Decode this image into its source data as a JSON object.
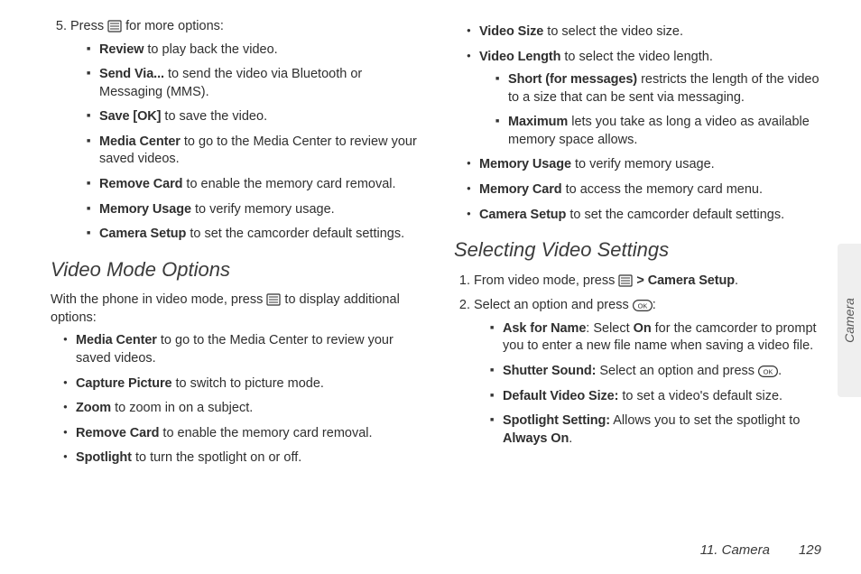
{
  "left": {
    "step5_lead": "Press ",
    "step5_tail": " for more options:",
    "step5_items": [
      {
        "term": "Review",
        "rest": " to play back the video."
      },
      {
        "term": "Send Via...",
        "rest": " to send the video via Bluetooth or Messaging (MMS)."
      },
      {
        "term": "Save [OK]",
        "rest": " to save the video."
      },
      {
        "term": "Media Center",
        "rest": " to go to the Media Center to review your saved videos."
      },
      {
        "term": "Remove Card",
        "rest": " to enable the memory card removal."
      },
      {
        "term": "Memory Usage",
        "rest": " to verify memory usage."
      },
      {
        "term": "Camera Setup",
        "rest": " to set the camcorder default settings."
      }
    ],
    "heading": "Video Mode Options",
    "intro_lead": "With the phone in video mode, press ",
    "intro_tail": " to display additional options:",
    "bullets": [
      {
        "term": "Media Center",
        "rest": " to go to the Media Center to review your saved videos."
      },
      {
        "term": "Capture Picture",
        "rest": " to switch to picture mode."
      },
      {
        "term": "Zoom",
        "rest": " to zoom in on a subject."
      },
      {
        "term": "Remove Card",
        "rest": " to enable the memory card removal."
      },
      {
        "term": "Spotlight",
        "rest": " to turn the spotlight on or off."
      }
    ]
  },
  "right": {
    "top_bullets": [
      {
        "term": "Video Size",
        "rest": " to select the video size."
      },
      {
        "term": "Video Length",
        "rest": " to select the video length.",
        "sub": [
          {
            "term": "Short (for messages)",
            "rest": " restricts the length of the video to a size that can be sent via messaging."
          },
          {
            "term": "Maximum",
            "rest": " lets you take as long a video as available memory space allows."
          }
        ]
      },
      {
        "term": "Memory Usage",
        "rest": " to verify memory usage."
      },
      {
        "term": "Memory Card",
        "rest": " to access the memory card menu."
      },
      {
        "term": "Camera Setup",
        "rest": " to set the camcorder default settings."
      }
    ],
    "heading": "Selecting Video Settings",
    "steps": {
      "s1_lead": "From video mode, press ",
      "s1_gt": " > ",
      "s1_term": "Camera Setup",
      "s1_tail": ".",
      "s2_lead": "Select an option and press ",
      "s2_tail": ":",
      "s2_items": [
        {
          "term": "Ask for Name",
          "mid1": ": Select ",
          "term2": "On",
          "rest": " for the camcorder to prompt you to enter a new file name when saving a video file."
        },
        {
          "term": "Shutter Sound:",
          "mid1": " Select an option and press ",
          "rest": "."
        },
        {
          "term": "Default Video Size:",
          "rest": " to set a video's default size."
        },
        {
          "term": "Spotlight Setting:",
          "mid1": " Allows you to set the spotlight to ",
          "term2": "Always On",
          "rest": "."
        }
      ]
    }
  },
  "side_label": "Camera",
  "footer_section": "11. Camera",
  "footer_page": "129"
}
